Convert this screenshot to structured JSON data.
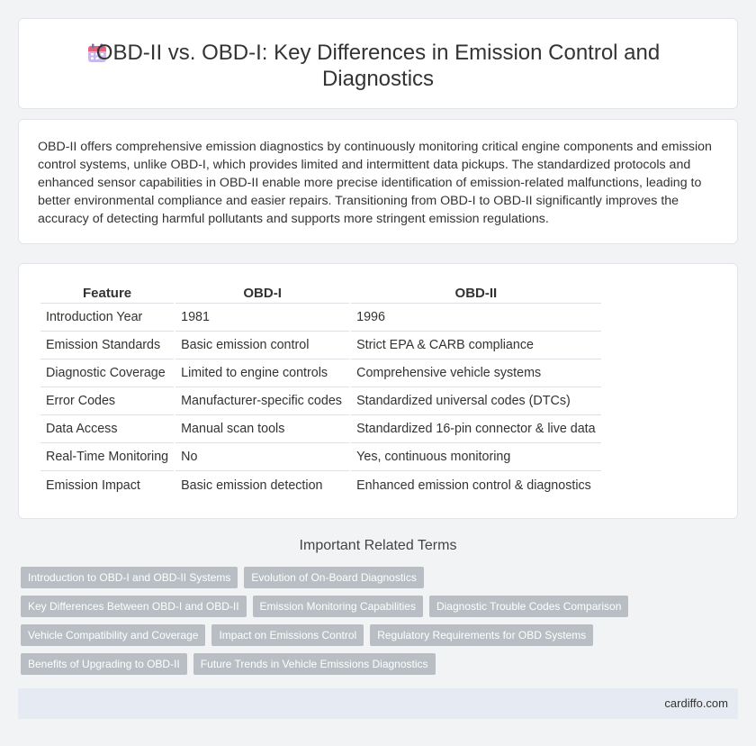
{
  "header": {
    "title": "OBD-II vs. OBD-I: Key Differences in Emission Control and Diagnostics",
    "icon": "calendar-icon"
  },
  "intro": {
    "text": "OBD-II offers comprehensive emission diagnostics by continuously monitoring critical engine components and emission control systems, unlike OBD-I, which provides limited and intermittent data pickups. The standardized protocols and enhanced sensor capabilities in OBD-II enable more precise identification of emission-related malfunctions, leading to better environmental compliance and easier repairs. Transitioning from OBD-I to OBD-II significantly improves the accuracy of detecting harmful pollutants and supports more stringent emission regulations."
  },
  "table": {
    "headers": [
      "Feature",
      "OBD-I",
      "OBD-II"
    ],
    "rows": [
      [
        "Introduction Year",
        "1981",
        "1996"
      ],
      [
        "Emission Standards",
        "Basic emission control",
        "Strict EPA & CARB compliance"
      ],
      [
        "Diagnostic Coverage",
        "Limited to engine controls",
        "Comprehensive vehicle systems"
      ],
      [
        "Error Codes",
        "Manufacturer-specific codes",
        "Standardized universal codes (DTCs)"
      ],
      [
        "Data Access",
        "Manual scan tools",
        "Standardized 16-pin connector & live data"
      ],
      [
        "Real-Time Monitoring",
        "No",
        "Yes, continuous monitoring"
      ],
      [
        "Emission Impact",
        "Basic emission detection",
        "Enhanced emission control & diagnostics"
      ]
    ]
  },
  "related": {
    "heading": "Important Related Terms",
    "tags": [
      "Introduction to OBD-I and OBD-II Systems",
      "Evolution of On-Board Diagnostics",
      "Key Differences Between OBD-I and OBD-II",
      "Emission Monitoring Capabilities",
      "Diagnostic Trouble Codes Comparison",
      "Vehicle Compatibility and Coverage",
      "Impact on Emissions Control",
      "Regulatory Requirements for OBD Systems",
      "Benefits of Upgrading to OBD-II",
      "Future Trends in Vehicle Emissions Diagnostics"
    ]
  },
  "footer": {
    "site": "cardiffo.com"
  },
  "colors": {
    "tag_bg": "#b9bec5",
    "footer_bg": "#e6eaf2",
    "page_bg": "#f2f3f5"
  }
}
